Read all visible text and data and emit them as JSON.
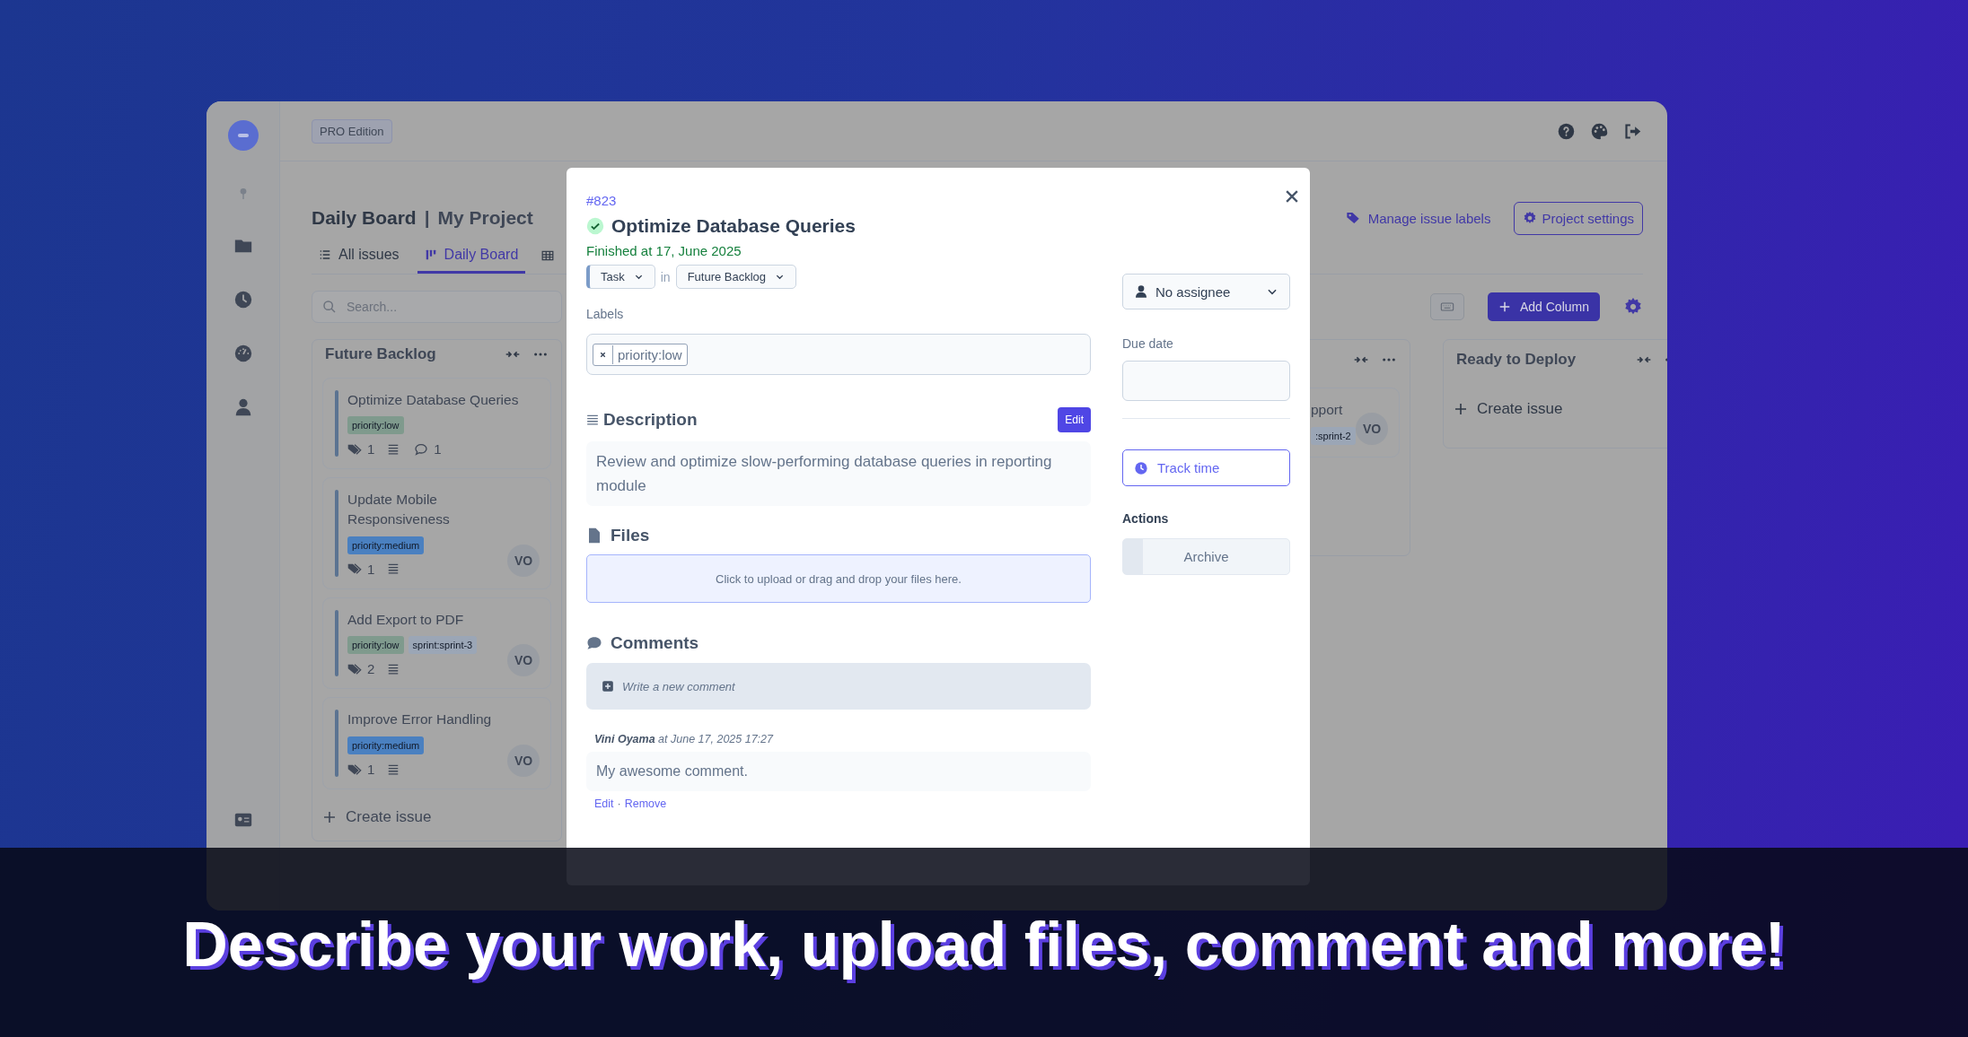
{
  "topbar": {
    "edition": "PRO Edition"
  },
  "header": {
    "board": "Daily Board",
    "separator": "|",
    "project": "My Project",
    "links": [
      {
        "label": "Manage issue labels",
        "kind": "link"
      },
      {
        "label": "Project settings",
        "kind": "outlined"
      }
    ]
  },
  "tabs": [
    {
      "label": "All issues",
      "selected": false
    },
    {
      "label": "Daily Board",
      "selected": true
    }
  ],
  "search": {
    "placeholder": "Search..."
  },
  "toolbar": {
    "add_column": "Add Column"
  },
  "columns": [
    {
      "kind": "full",
      "title": "Future Backlog",
      "create": "Create issue",
      "cards": [
        {
          "title": "Optimize Database Queries",
          "labels": [
            {
              "text": "priority:low",
              "color": "#7f9a8d"
            }
          ],
          "label_count": "1",
          "has_description": true,
          "comments": "1"
        },
        {
          "title": "Update Mobile Responsiveness",
          "labels": [
            {
              "text": "priority:medium",
              "color": "#4a80c0"
            }
          ],
          "label_count": "1",
          "has_description": true,
          "assignee": "VO"
        },
        {
          "title": "Add Export to PDF",
          "labels": [
            {
              "text": "priority:low",
              "color": "#7f9a8d"
            },
            {
              "text": "sprint:sprint-3",
              "color": "#9ba6b6"
            }
          ],
          "label_count": "2",
          "has_description": true,
          "assignee": "VO"
        },
        {
          "title": "Improve Error Handling",
          "labels": [
            {
              "text": "priority:medium",
              "color": "#4a80c0"
            }
          ],
          "label_count": "1",
          "has_description": true,
          "assignee": "VO"
        }
      ]
    },
    {
      "kind": "partial",
      "cards": [
        {
          "title": "pport",
          "labels": [
            {
              "text": ":sprint-2",
              "color": "#9ba6b6"
            }
          ],
          "assignee": "VO"
        }
      ]
    },
    {
      "kind": "full",
      "title": "Ready to Deploy",
      "create": "Create issue"
    }
  ],
  "modal": {
    "number": "#823",
    "title": "Optimize Database Queries",
    "finished": true,
    "finished_text": "Finished at 17, June 2025",
    "type": "Task",
    "in": "in",
    "column": "Future Backlog",
    "labels_label": "Labels",
    "labels": [
      "priority:low"
    ],
    "description_heading": "Description",
    "edit": "Edit",
    "description": "Review and optimize slow-performing database queries in reporting module",
    "files_heading": "Files",
    "dropzone": "Click to upload or drag and drop your files here.",
    "comments_heading": "Comments",
    "new_comment": "Write a new comment",
    "comments": [
      {
        "meta": "**Vini Oyama** at June 17, 2025 17:27",
        "text": "My awesome comment.",
        "edit": "Edit",
        "separator": "·",
        "remove": "Remove"
      }
    ],
    "assignee": "No assignee",
    "due_date_label": "Due date",
    "track_time": "Track time",
    "actions_label": "Actions",
    "archive": "Archive"
  },
  "banner": {
    "text": "Describe your work, upload files, comment and more!"
  }
}
